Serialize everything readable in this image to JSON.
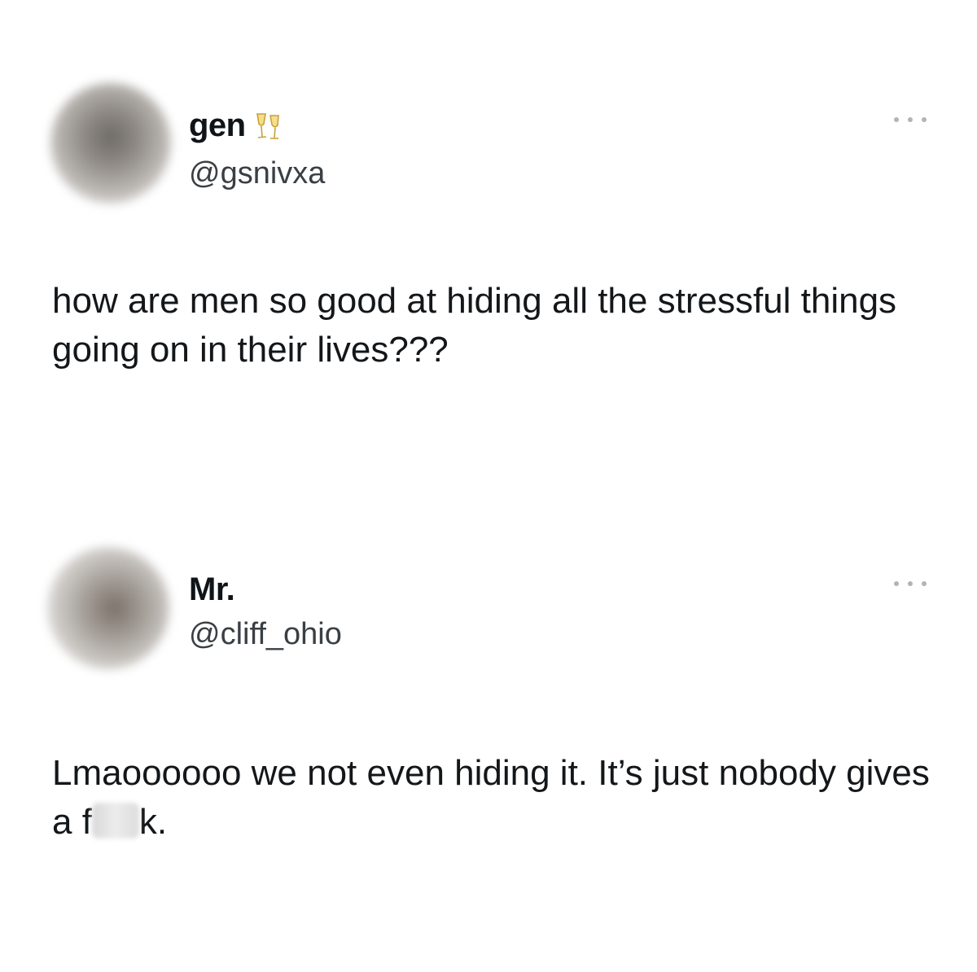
{
  "tweets": [
    {
      "display_name": "gen",
      "name_emoji": "clinking-glasses-icon",
      "handle": "@gsnivxa",
      "text": "how are men so good at hiding all the stressful things going on in their lives???"
    },
    {
      "display_name": "Mr.",
      "handle": "@cliff_ohio",
      "text_before": "Lmaoooooo we not even hiding it. It’s just nobody gives a f",
      "text_after": "k."
    }
  ],
  "colors": {
    "name": "#0f1419",
    "handle": "#3a3f44",
    "body": "#14171a",
    "more_dots": "#b0b4b8"
  },
  "icons": {
    "more": "more-options-icon",
    "emoji": "clinking-glasses-icon"
  }
}
